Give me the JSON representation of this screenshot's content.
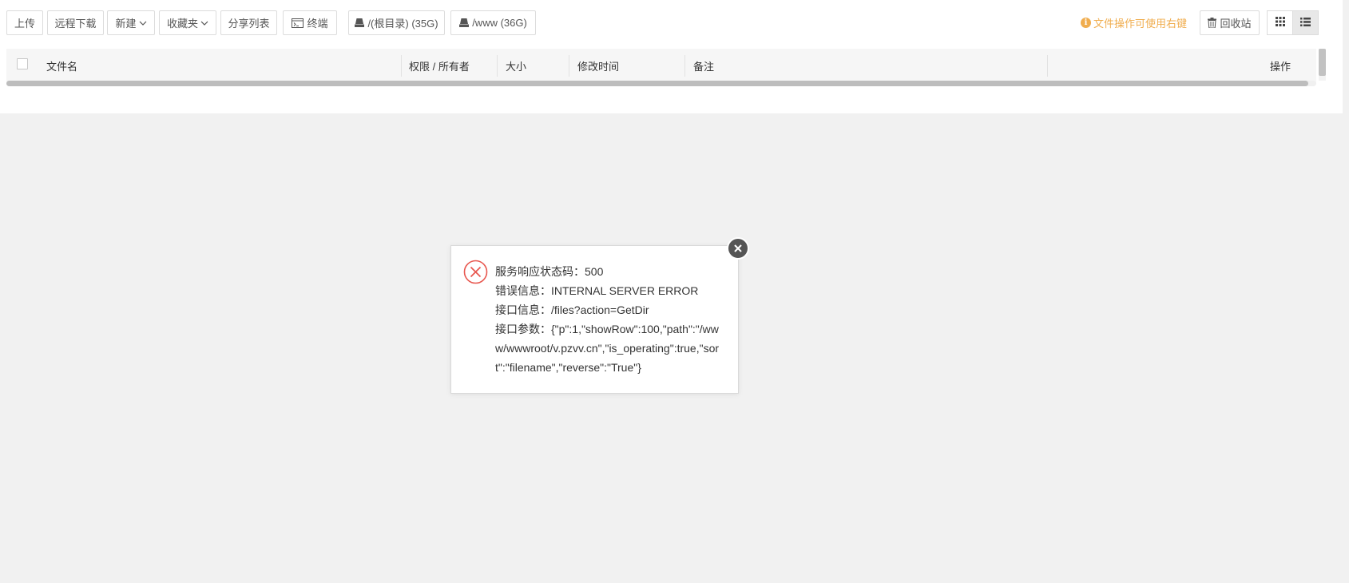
{
  "toolbar": {
    "upload": "上传",
    "remote_download": "远程下载",
    "new": "新建",
    "favorites": "收藏夹",
    "share_list": "分享列表",
    "terminal": "终端",
    "disk_root": "/(根目录) (35G)",
    "disk_www": "/www (36G)",
    "hint": "文件操作可使用右键",
    "recycle_bin": "回收站"
  },
  "table": {
    "headers": {
      "filename": "文件名",
      "permission": "权限 / 所有者",
      "size": "大小",
      "mtime": "修改时间",
      "remark": "备注",
      "actions": "操作"
    }
  },
  "error_dialog": {
    "status": "服务响应状态码：500",
    "message": "错误信息：INTERNAL SERVER ERROR",
    "api": "接口信息：/files?action=GetDir",
    "params": "接口参数：{\"p\":1,\"showRow\":100,\"path\":\"/www/wwwroot/v.pzvv.cn\",\"is_operating\":true,\"sort\":\"filename\",\"reverse\":\"True\"}"
  },
  "colors": {
    "hint": "#f0ad4e",
    "error": "#e8574f",
    "background": "#f1f1f1"
  },
  "icons": {
    "terminal": "terminal-icon",
    "disk": "disk-icon",
    "info": "info-icon",
    "trash": "trash-icon",
    "grid_view": "grid-view-icon",
    "list_view": "list-view-icon",
    "error": "error-circle-x-icon",
    "close": "close-icon"
  }
}
